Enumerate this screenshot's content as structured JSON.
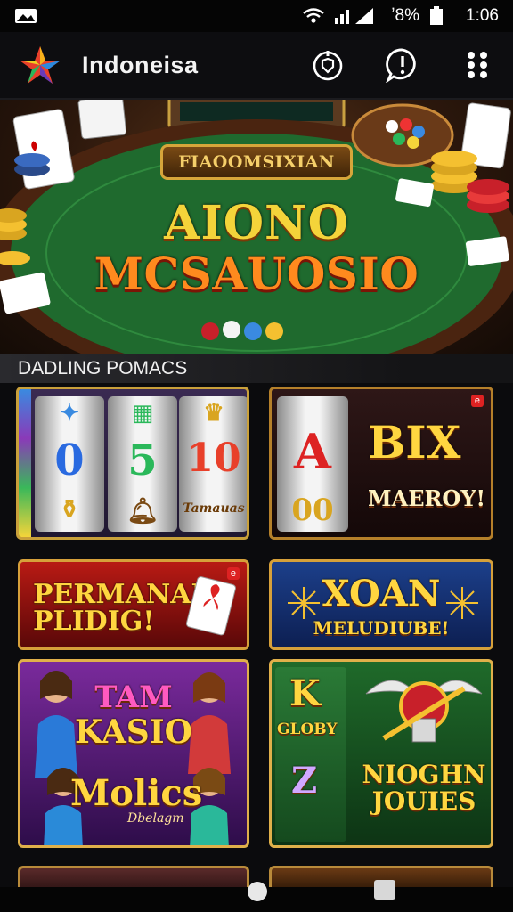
{
  "status_bar": {
    "battery": "ʼ8%",
    "time": "1:06",
    "icons": [
      "notification-icon",
      "wifi-icon",
      "signal-icon",
      "battery-icon"
    ]
  },
  "app_bar": {
    "title": "Indoneisa",
    "icons": [
      "app-logo-icon",
      "shield-power-icon",
      "alert-bubble-icon",
      "grid-menu-icon"
    ]
  },
  "hero": {
    "plaque": "FIAOOMSIXIAN",
    "title_line1": "AIONO",
    "title_line2": "MCSAUOSIO"
  },
  "section": {
    "title": "DADLING POMACS"
  },
  "tiles": [
    {
      "reel1": "0",
      "reel2": "5",
      "reel3": "10",
      "caption": "Tamauas"
    },
    {
      "big": "BIX",
      "sub": "MAEROY!",
      "reel_a": "A",
      "reel_b": "00",
      "badge": "e"
    },
    {
      "line1": "PERMANAN",
      "line2": "PLIDIG!",
      "badge": "e"
    },
    {
      "line1": "XOAN",
      "line2": "MELUDIUBE!"
    },
    {
      "line1": "TAM",
      "line2": "KASIO",
      "line3": "Molics",
      "line4": "Dbelagm"
    },
    {
      "k": "K",
      "glory": "GLOBY",
      "z": "Z",
      "name": "NIOGHN JOUIES"
    },
    {},
    {}
  ],
  "colors": {
    "gold": "#d6a63a",
    "felt": "#1f6a2e",
    "title_yellow": "#f4d43a",
    "title_orange": "#ff8a1e"
  }
}
